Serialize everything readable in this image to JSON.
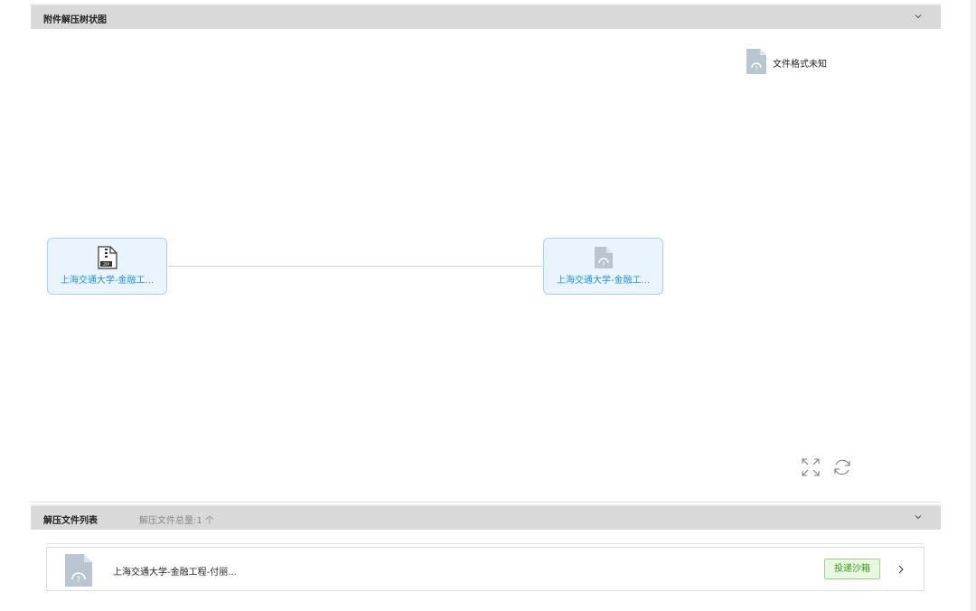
{
  "tree_section": {
    "title": "附件解压树状图",
    "legend_label": "文件格式未知",
    "nodes": [
      {
        "label": "上海交通大学-金融工...",
        "icon": "zip-file-icon"
      },
      {
        "label": "上海交通大学-金融工...",
        "icon": "unknown-file-icon"
      }
    ],
    "tools": [
      "fullscreen-icon",
      "refresh-icon"
    ]
  },
  "list_section": {
    "title": "解压文件列表",
    "summary": "解压文件总量:1 个",
    "files": [
      {
        "name": "上海交通大学-金融工程-付丽...",
        "action_label": "投递沙箱"
      }
    ]
  },
  "colors": {
    "header_bg": "#d9d9d9",
    "node_bg": "#eaf4ff",
    "node_border": "#a7d0f4",
    "node_text": "#1e8fe1",
    "sandbox_text": "#3a9b14",
    "sandbox_bg": "#eaf7e2"
  }
}
